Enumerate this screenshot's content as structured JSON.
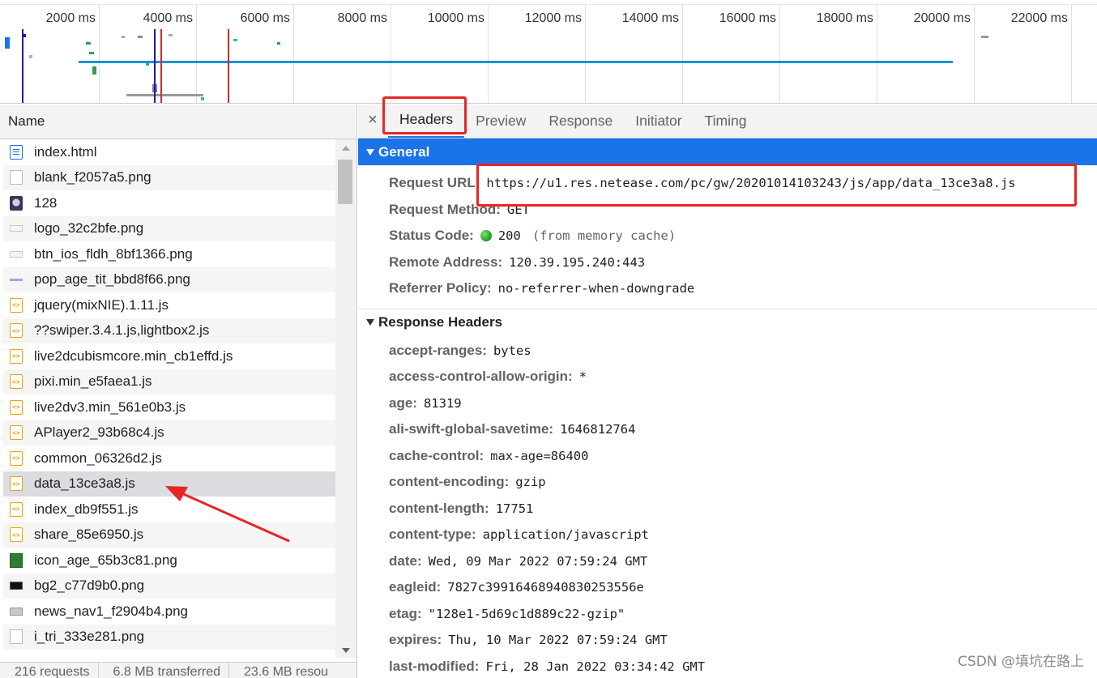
{
  "timeline": {
    "ticks": [
      "2000 ms",
      "4000 ms",
      "6000 ms",
      "8000 ms",
      "10000 ms",
      "12000 ms",
      "14000 ms",
      "16000 ms",
      "18000 ms",
      "20000 ms",
      "22000 ms"
    ],
    "colors": {
      "dom_content_loaded": "#1a1aa6",
      "load": "#d12a2a",
      "request_bar": "#1a93d0",
      "pending": "#999999"
    }
  },
  "requests": {
    "column_header": "Name",
    "items": [
      {
        "name": "index.html",
        "icon": "document-icon"
      },
      {
        "name": "blank_f2057a5.png",
        "icon": "image-icon"
      },
      {
        "name": "128",
        "icon": "avatar-image-icon"
      },
      {
        "name": "logo_32c2bfe.png",
        "icon": "image-icon"
      },
      {
        "name": "btn_ios_fldh_8bf1366.png",
        "icon": "image-icon"
      },
      {
        "name": "pop_age_tit_bbd8f66.png",
        "icon": "image-icon"
      },
      {
        "name": "jquery(mixNIE).1.11.js",
        "icon": "script-icon"
      },
      {
        "name": "??swiper.3.4.1.js,lightbox2.js",
        "icon": "script-icon"
      },
      {
        "name": "live2dcubismcore.min_cb1effd.js",
        "icon": "script-icon"
      },
      {
        "name": "pixi.min_e5faea1.js",
        "icon": "script-icon"
      },
      {
        "name": "live2dv3.min_561e0b3.js",
        "icon": "script-icon"
      },
      {
        "name": "APlayer2_93b68c4.js",
        "icon": "script-icon"
      },
      {
        "name": "common_06326d2.js",
        "icon": "script-icon"
      },
      {
        "name": "data_13ce3a8.js",
        "icon": "script-icon",
        "selected": true
      },
      {
        "name": "index_db9f551.js",
        "icon": "script-icon"
      },
      {
        "name": "share_85e6950.js",
        "icon": "script-icon"
      },
      {
        "name": "icon_age_65b3c81.png",
        "icon": "image-icon"
      },
      {
        "name": "bg2_c77d9b0.png",
        "icon": "image-icon"
      },
      {
        "name": "news_nav1_f2904b4.png",
        "icon": "image-icon"
      },
      {
        "name": "i_tri_333e281.png",
        "icon": "image-icon"
      }
    ]
  },
  "status_bar": {
    "requests": "216 requests",
    "transferred": "6.8 MB transferred",
    "resources": "23.6 MB resou"
  },
  "detail": {
    "close_glyph": "×",
    "tabs": [
      "Headers",
      "Preview",
      "Response",
      "Initiator",
      "Timing"
    ],
    "active_tab": "Headers",
    "general": {
      "title": "General",
      "request_url_label": "Request URL:",
      "request_url": "https://u1.res.netease.com/pc/gw/20201014103243/js/app/data_13ce3a8.js",
      "request_method_label": "Request Method:",
      "request_method": "GET",
      "status_code_label": "Status Code:",
      "status_code": "200",
      "status_note": "(from memory cache)",
      "remote_address_label": "Remote Address:",
      "remote_address": "120.39.195.240:443",
      "referrer_policy_label": "Referrer Policy:",
      "referrer_policy": "no-referrer-when-downgrade"
    },
    "response_headers": {
      "title": "Response Headers",
      "items": [
        {
          "key": "accept-ranges:",
          "value": "bytes"
        },
        {
          "key": "access-control-allow-origin:",
          "value": "*"
        },
        {
          "key": "age:",
          "value": "81319"
        },
        {
          "key": "ali-swift-global-savetime:",
          "value": "1646812764"
        },
        {
          "key": "cache-control:",
          "value": "max-age=86400"
        },
        {
          "key": "content-encoding:",
          "value": "gzip"
        },
        {
          "key": "content-length:",
          "value": "17751"
        },
        {
          "key": "content-type:",
          "value": "application/javascript"
        },
        {
          "key": "date:",
          "value": "Wed, 09 Mar 2022 07:59:24 GMT"
        },
        {
          "key": "eagleid:",
          "value": "7827c39916468940830253556e"
        },
        {
          "key": "etag:",
          "value": "\"128e1-5d69c1d889c22-gzip\""
        },
        {
          "key": "expires:",
          "value": "Thu, 10 Mar 2022 07:59:24 GMT"
        },
        {
          "key": "last-modified:",
          "value": "Fri, 28 Jan 2022 03:34:42 GMT"
        }
      ]
    }
  },
  "watermark": "CSDN @填坑在路上",
  "annotation_color": "#e82525"
}
